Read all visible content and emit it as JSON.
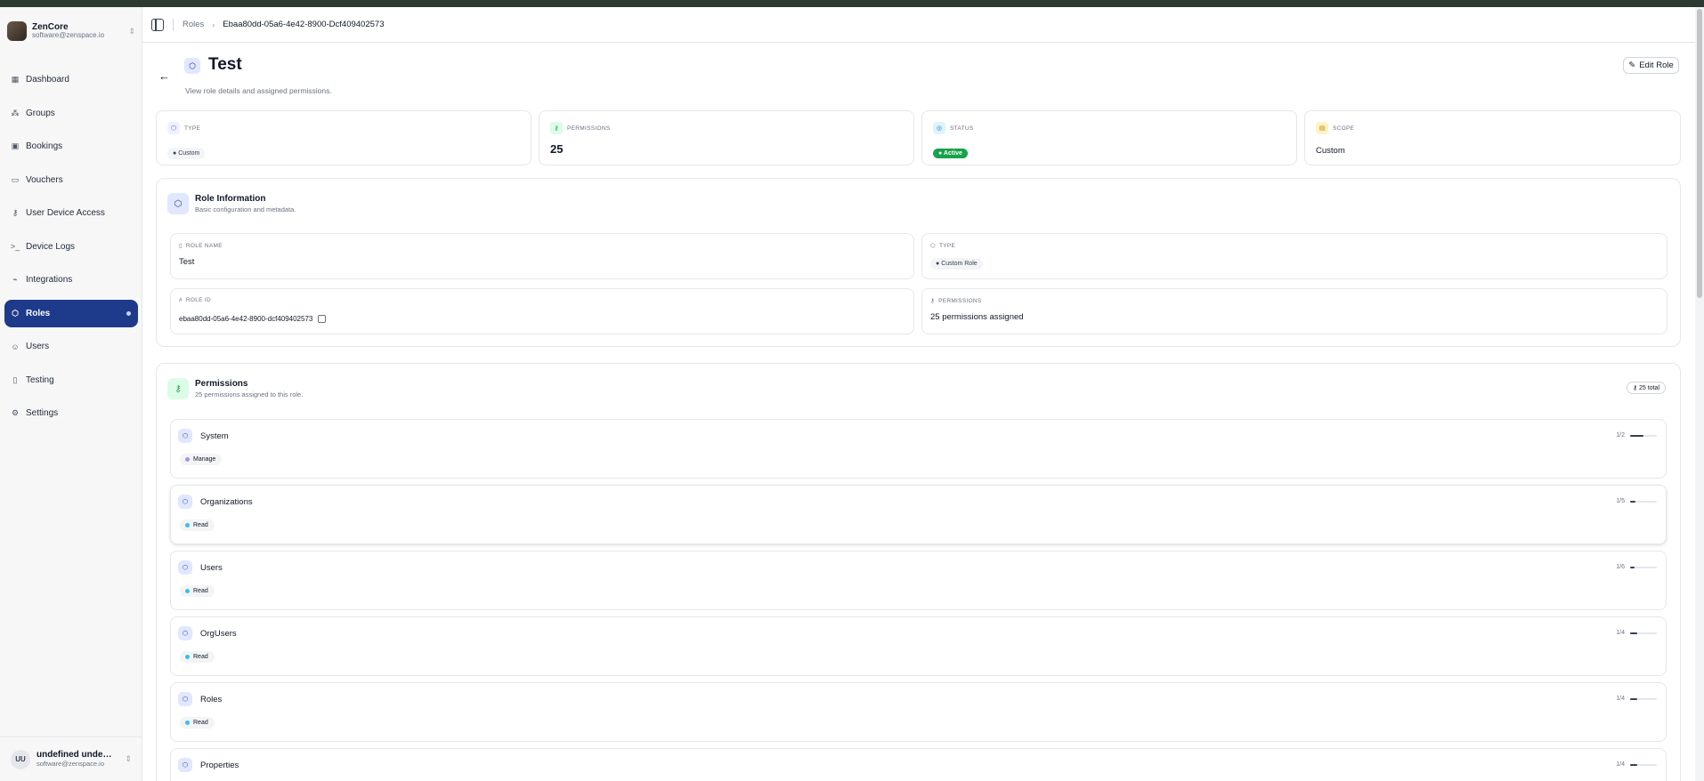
{
  "sidebar": {
    "org_name": "ZenCore",
    "org_email": "software@zenspace.io",
    "items": [
      {
        "label": "Dashboard",
        "icon": "grid-icon"
      },
      {
        "label": "Groups",
        "icon": "group-icon"
      },
      {
        "label": "Bookings",
        "icon": "calendar-icon"
      },
      {
        "label": "Vouchers",
        "icon": "ticket-icon"
      },
      {
        "label": "User Device Access",
        "icon": "key-icon"
      },
      {
        "label": "Device Logs",
        "icon": "terminal-icon"
      },
      {
        "label": "Integrations",
        "icon": "plug-icon"
      },
      {
        "label": "Roles",
        "icon": "shield-icon",
        "active": true
      },
      {
        "label": "Users",
        "icon": "users-icon"
      },
      {
        "label": "Testing",
        "icon": "flask-icon"
      },
      {
        "label": "Settings",
        "icon": "gear-icon"
      }
    ],
    "user_initials": "UU",
    "user_name": "undefined undefin...",
    "user_email": "software@zenspace.io"
  },
  "header": {
    "crumb_root": "Roles",
    "crumb_separator": "›",
    "crumb_current": "Ebaa80dd-05a6-4e42-8900-Dcf409402573"
  },
  "page": {
    "title": "Test",
    "subtitle": "View role details and assigned permissions.",
    "edit_label": "Edit Role"
  },
  "stats": {
    "type_label": "TYPE",
    "type_value": "Custom",
    "permissions_label": "PERMISSIONS",
    "permissions_value": "25",
    "status_label": "STATUS",
    "status_value": "Active",
    "scope_label": "SCOPE",
    "scope_value": "Custom"
  },
  "role_info": {
    "title": "Role Information",
    "subtitle": "Basic configuration and metadata.",
    "name_label": "ROLE NAME",
    "name_value": "Test",
    "type_label": "TYPE",
    "type_value": "Custom Role",
    "id_label": "ROLE ID",
    "id_value": "ebaa80dd-05a6-4e42-8900-dcf409402573",
    "perm_label": "PERMISSIONS",
    "perm_value": "25 permissions assigned"
  },
  "permissions": {
    "title": "Permissions",
    "subtitle": "25 permissions assigned to this role.",
    "total_badge": "25 total",
    "groups": [
      {
        "name": "System",
        "chip": "Manage",
        "chip_color": "#a78bfa",
        "count": "1/2",
        "fraction": 0.5
      },
      {
        "name": "Organizations",
        "chip": "Read",
        "chip_color": "#38bdf8",
        "count": "1/5",
        "fraction": 0.2
      },
      {
        "name": "Users",
        "chip": "Read",
        "chip_color": "#38bdf8",
        "count": "1/6",
        "fraction": 0.17
      },
      {
        "name": "OrgUsers",
        "chip": "Read",
        "chip_color": "#38bdf8",
        "count": "1/4",
        "fraction": 0.25
      },
      {
        "name": "Roles",
        "chip": "Read",
        "chip_color": "#38bdf8",
        "count": "1/4",
        "fraction": 0.25
      },
      {
        "name": "Properties",
        "chip": "",
        "chip_color": "#38bdf8",
        "count": "1/4",
        "fraction": 0.25
      }
    ]
  },
  "colors": {
    "accent": "#1e3a8a",
    "active_green": "#16a34a"
  }
}
